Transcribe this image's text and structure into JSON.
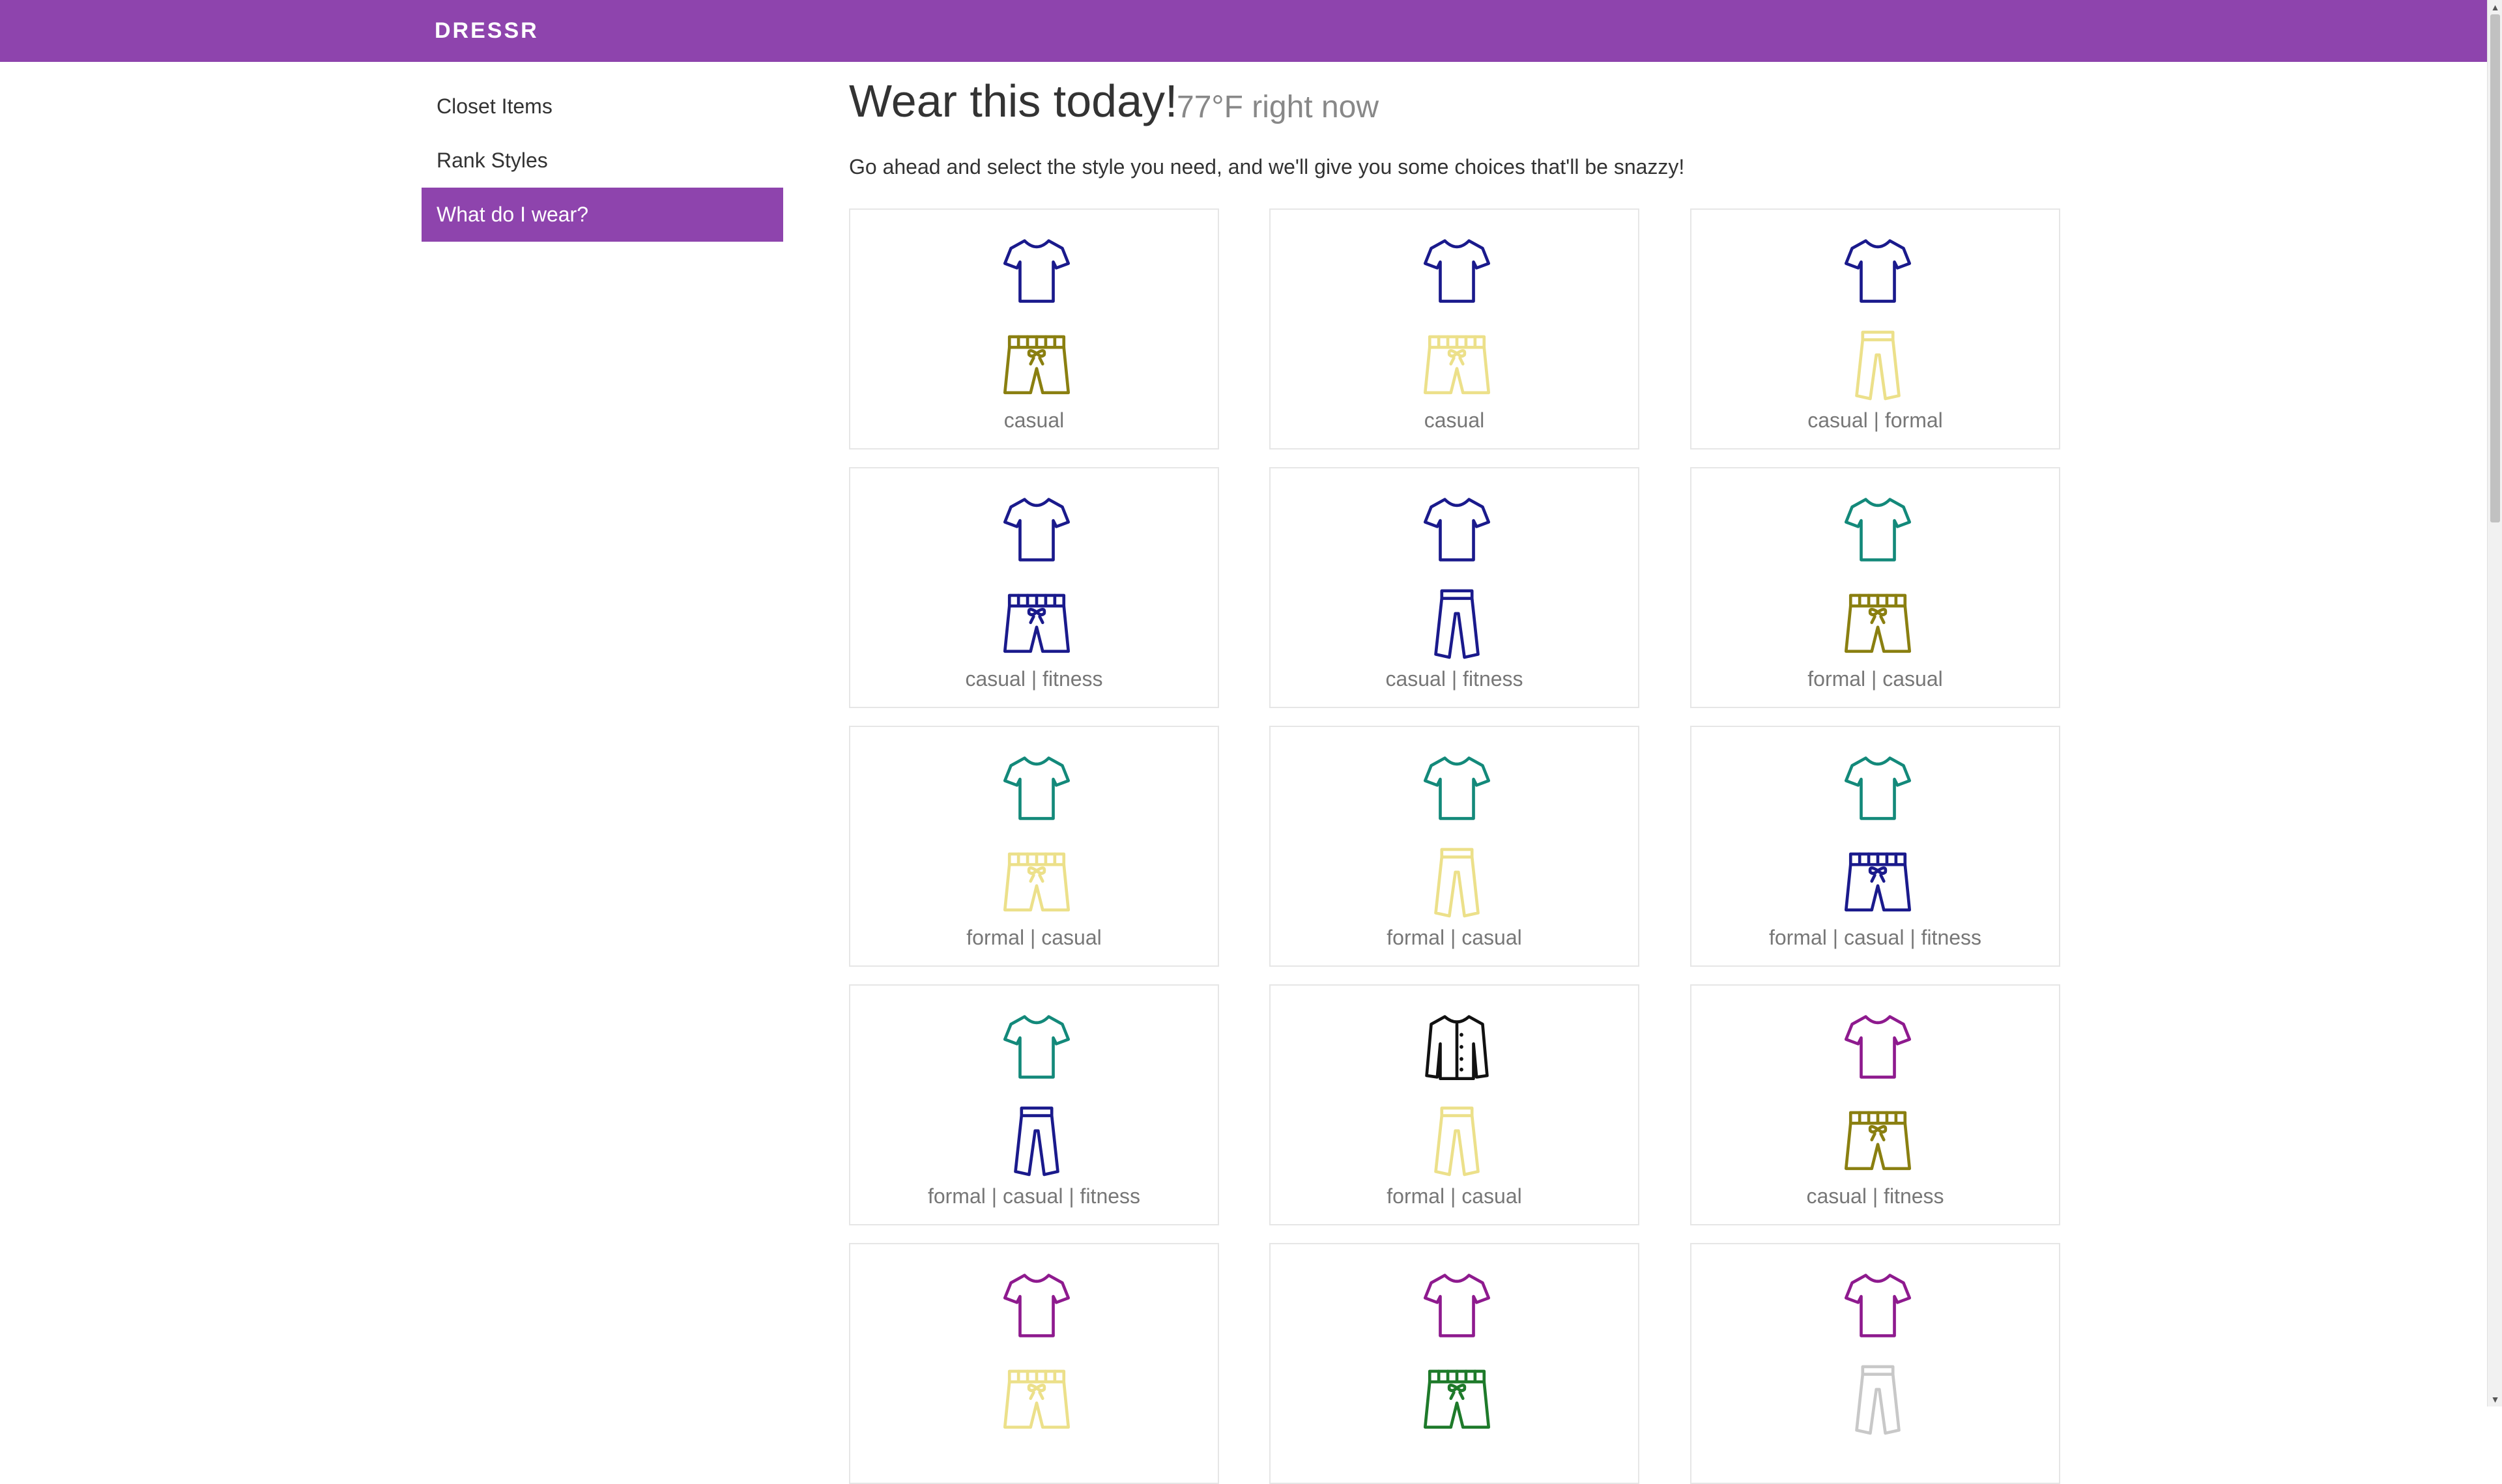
{
  "navbar": {
    "brand": "DRESSR",
    "color": "#8e44ad"
  },
  "sidebar": {
    "items": [
      {
        "label": "Closet Items",
        "active": false
      },
      {
        "label": "Rank Styles",
        "active": false
      },
      {
        "label": "What do I wear?",
        "active": true
      }
    ]
  },
  "main": {
    "title": "Wear this today!",
    "temperature": "77°F right now",
    "intro": "Go ahead and select the style you need, and we'll give you some choices that'll be snazzy!"
  },
  "outfits": [
    {
      "top": "tshirt",
      "top_color": "#1a1a8c",
      "bottom": "shorts",
      "bottom_color": "#8a7f10",
      "label": "casual"
    },
    {
      "top": "tshirt",
      "top_color": "#1a1a8c",
      "bottom": "shorts",
      "bottom_color": "#ece08a",
      "label": "casual"
    },
    {
      "top": "tshirt",
      "top_color": "#1a1a8c",
      "bottom": "pants",
      "bottom_color": "#ece08a",
      "label": "casual | formal"
    },
    {
      "top": "tshirt",
      "top_color": "#1a1a8c",
      "bottom": "shorts",
      "bottom_color": "#1a1a8c",
      "label": "casual | fitness"
    },
    {
      "top": "tshirt",
      "top_color": "#1a1a8c",
      "bottom": "pants",
      "bottom_color": "#1a1a8c",
      "label": "casual | fitness"
    },
    {
      "top": "tshirt",
      "top_color": "#13897a",
      "bottom": "shorts",
      "bottom_color": "#8a7f10",
      "label": "formal | casual"
    },
    {
      "top": "tshirt",
      "top_color": "#13897a",
      "bottom": "shorts",
      "bottom_color": "#ece08a",
      "label": "formal | casual"
    },
    {
      "top": "tshirt",
      "top_color": "#13897a",
      "bottom": "pants",
      "bottom_color": "#ece08a",
      "label": "formal | casual"
    },
    {
      "top": "tshirt",
      "top_color": "#13897a",
      "bottom": "shorts",
      "bottom_color": "#1a1a8c",
      "label": "formal | casual | fitness"
    },
    {
      "top": "tshirt",
      "top_color": "#13897a",
      "bottom": "pants",
      "bottom_color": "#1a1a8c",
      "label": "formal | casual | fitness"
    },
    {
      "top": "jacket",
      "top_color": "#111111",
      "bottom": "pants",
      "bottom_color": "#ece08a",
      "label": "formal | casual"
    },
    {
      "top": "tshirt",
      "top_color": "#8e1a8e",
      "bottom": "shorts",
      "bottom_color": "#8a7f10",
      "label": "casual | fitness"
    },
    {
      "top": "tshirt",
      "top_color": "#8e1a8e",
      "bottom": "shorts",
      "bottom_color": "#ece08a",
      "label": ""
    },
    {
      "top": "tshirt",
      "top_color": "#8e1a8e",
      "bottom": "shorts",
      "bottom_color": "#1e7a2a",
      "label": ""
    },
    {
      "top": "tshirt",
      "top_color": "#8e1a8e",
      "bottom": "pants",
      "bottom_color": "#c8c8c8",
      "label": ""
    }
  ]
}
